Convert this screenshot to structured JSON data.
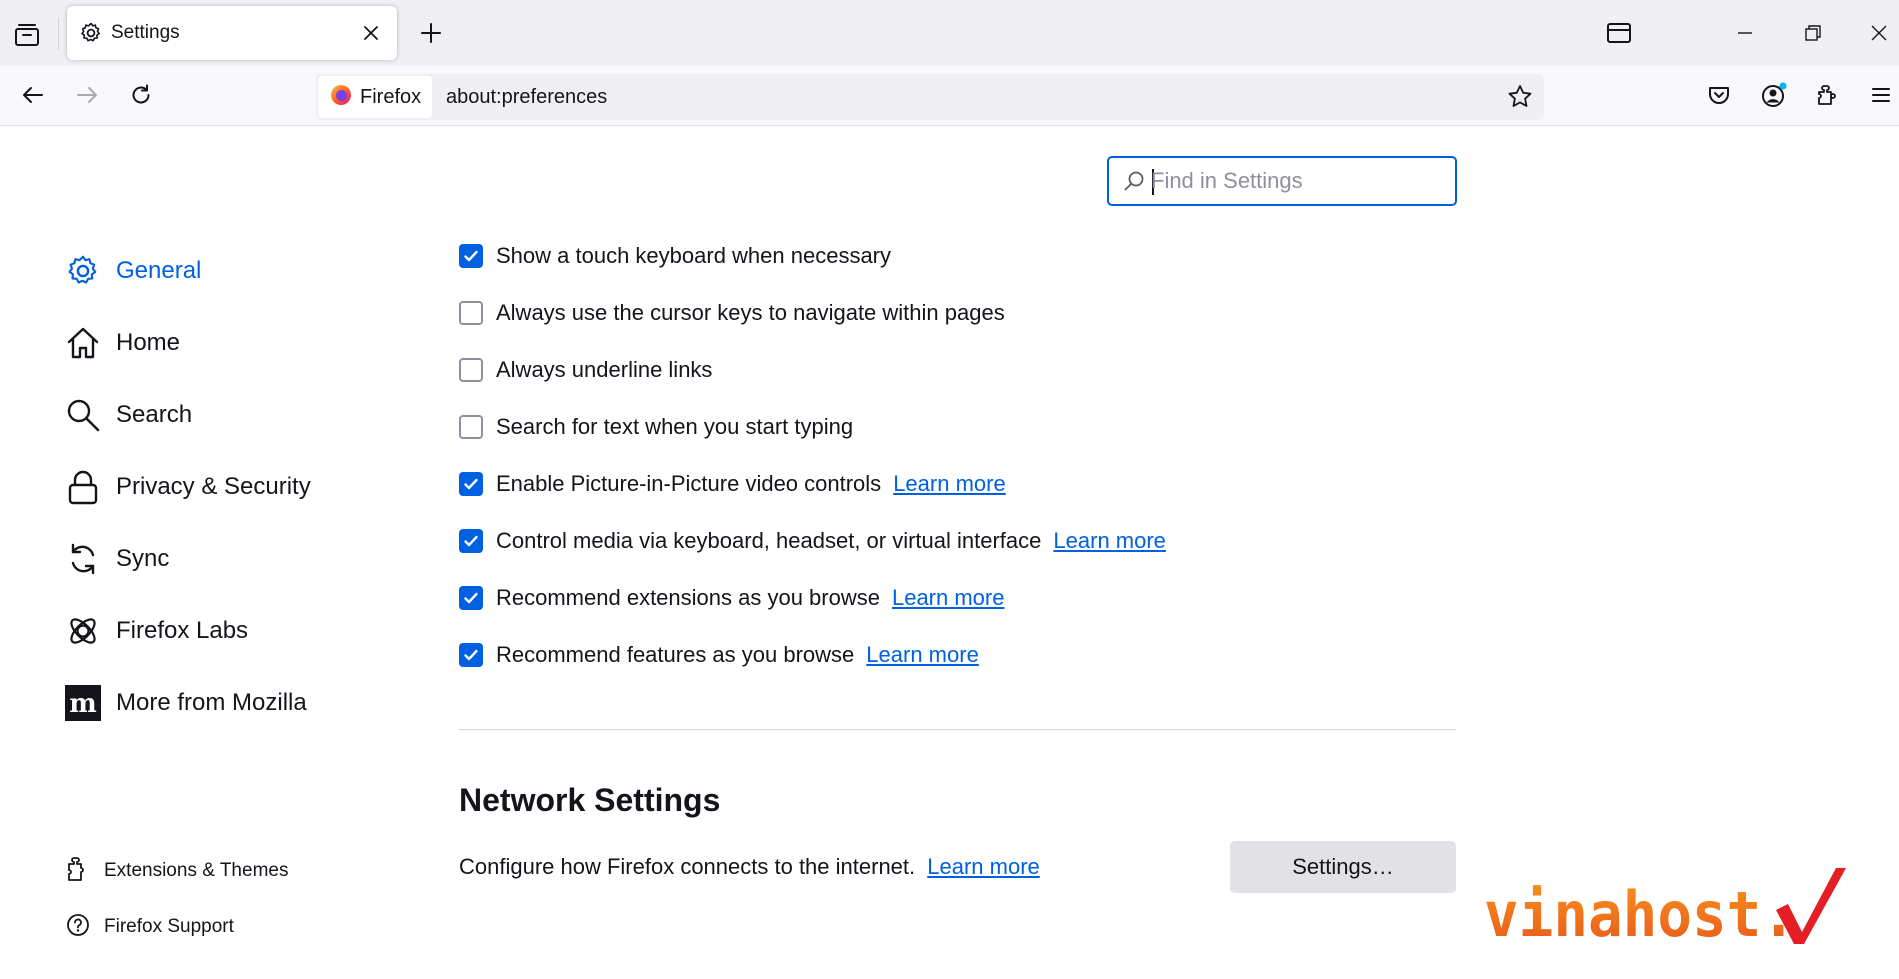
{
  "browser": {
    "tab": {
      "title": "Settings"
    },
    "identity_label": "Firefox",
    "url": "about:preferences",
    "accent": "#0061e0"
  },
  "search": {
    "placeholder": "Find in Settings"
  },
  "sidebar": {
    "items": [
      {
        "label": "General",
        "icon": "gear-icon",
        "selected": true
      },
      {
        "label": "Home",
        "icon": "home-icon"
      },
      {
        "label": "Search",
        "icon": "search-icon"
      },
      {
        "label": "Privacy & Security",
        "icon": "lock-icon"
      },
      {
        "label": "Sync",
        "icon": "sync-icon"
      },
      {
        "label": "Firefox Labs",
        "icon": "labs-icon"
      },
      {
        "label": "More from Mozilla",
        "icon": "mozilla-icon"
      }
    ],
    "footer": [
      {
        "label": "Extensions & Themes",
        "icon": "puzzle-icon"
      },
      {
        "label": "Firefox Support",
        "icon": "help-icon"
      }
    ]
  },
  "options": [
    {
      "label": "Show a touch keyboard when necessary",
      "checked": true
    },
    {
      "label": "Always use the cursor keys to navigate within pages",
      "checked": false
    },
    {
      "label": "Always underline links",
      "checked": false
    },
    {
      "label": "Search for text when you start typing",
      "checked": false
    },
    {
      "label": "Enable Picture-in-Picture video controls",
      "checked": true,
      "link": "Learn more"
    },
    {
      "label": "Control media via keyboard, headset, or virtual interface",
      "checked": true,
      "link": "Learn more"
    },
    {
      "label": "Recommend extensions as you browse",
      "checked": true,
      "link": "Learn more"
    },
    {
      "label": "Recommend features as you browse",
      "checked": true,
      "link": "Learn more"
    }
  ],
  "network": {
    "title": "Network Settings",
    "description": "Configure how Firefox connects to the internet.",
    "link": "Learn more",
    "button": "Settings…"
  },
  "watermark": {
    "text": "vinahost."
  }
}
